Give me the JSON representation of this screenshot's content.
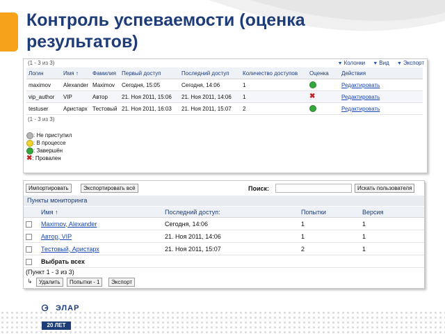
{
  "slide": {
    "title": "Контроль успеваемости (оценка результатов)"
  },
  "panel1": {
    "pager_top": "(1 - 3 из 3)",
    "pager_bottom": "(1 - 3 из 3)",
    "toolbar": {
      "columns": "Колонки",
      "view": "Вид",
      "export": "Экспорт"
    },
    "columns": [
      "Логин",
      "Имя",
      "Фамилия",
      "Первый доступ",
      "Последний доступ",
      "Количество доступов",
      "Оценка",
      "Действия"
    ],
    "sort_marker": "↑",
    "rows": [
      {
        "login": "maximov",
        "name": "Alexander",
        "surname": "Maximov",
        "first": "Сегодня, 15:05",
        "last": "Сегодня, 14:06",
        "count": "1",
        "grade": "completed",
        "action": "Редактировать"
      },
      {
        "login": "vip_author",
        "name": "VIP",
        "surname": "Автор",
        "first": "21. Ноя 2011, 15:06",
        "last": "21. Ноя 2011, 14:06",
        "count": "1",
        "grade": "failed",
        "action": "Редактировать"
      },
      {
        "login": "testuser",
        "name": "Аристарх",
        "surname": "Тестовый",
        "first": "21. Ноя 2011, 16:03",
        "last": "21. Ноя 2011, 15:07",
        "count": "2",
        "grade": "completed",
        "action": "Редактировать"
      }
    ],
    "legend": [
      {
        "status": "not-started",
        "text": ": Не приступил",
        "color": "#9a9a9a"
      },
      {
        "status": "in-progress",
        "text": ": В процессе",
        "color": "#f2d22e"
      },
      {
        "status": "completed",
        "text": ": Завершён",
        "color": "#35a83a"
      },
      {
        "status": "failed",
        "text": ": Провален",
        "color": "#c32222"
      }
    ]
  },
  "panel2": {
    "import_button": "Импортировать",
    "export_all_button": "Экспортировать всё",
    "search_label": "Поиск:",
    "search_value": "",
    "search_user_button": "Искать пользователя",
    "section_title": "Пункты мониторинга",
    "columns": [
      "Имя",
      "Последний доступ:",
      "Попытки",
      "Версия"
    ],
    "sort_marker": "↑",
    "rows": [
      {
        "name": "Maximov, Alexander",
        "last": "Сегодня, 14:06",
        "attempts": "1",
        "version": "1"
      },
      {
        "name": "Автор, VIP",
        "last": "21. Ноя 2011, 14:06",
        "attempts": "1",
        "version": "1"
      },
      {
        "name": "Тестовый, Аристарх",
        "last": "21. Ноя 2011, 15:07",
        "attempts": "2",
        "version": "1"
      }
    ],
    "select_all": "Выбрать всех",
    "pager": "(Пункт 1 - 3 из 3)",
    "delete_button": "Удалить",
    "attempts_button": "Попытки - 1",
    "export_button": "Экспорт"
  },
  "footer": {
    "logo_text": "ЭЛАР",
    "years": "20 ЛЕТ"
  },
  "colors": {
    "title": "#1d3c78",
    "accent": "#f6a21b",
    "link": "#1a47b8",
    "header_bg": "#eef1f6"
  }
}
